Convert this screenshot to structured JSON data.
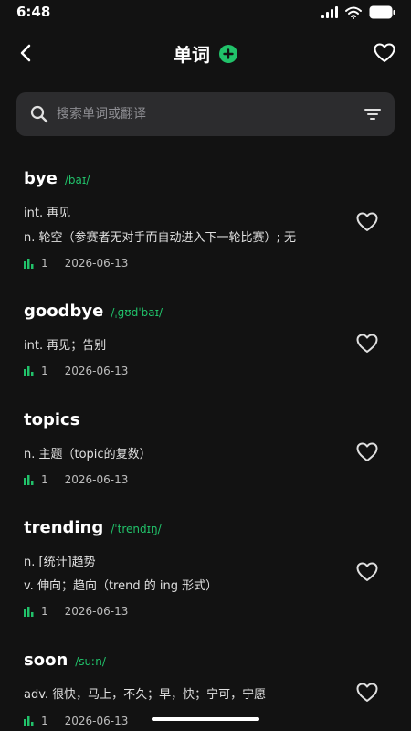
{
  "status_bar": {
    "time": "6:48"
  },
  "header": {
    "title": "单词"
  },
  "search": {
    "placeholder": "搜索单词或翻译"
  },
  "colors": {
    "accent": "#21c26a",
    "background": "#121212",
    "search_bg": "#2c2c2e"
  },
  "words": [
    {
      "word": "bye",
      "phonetic": "/baɪ/",
      "definitions": [
        "int. 再见",
        "n. 轮空（参赛者无对手而自动进入下一轮比赛）; 无"
      ],
      "count": "1",
      "date": "2026-06-13"
    },
    {
      "word": "goodbye",
      "phonetic": "/ˌɡʊdˈbaɪ/",
      "definitions": [
        "int. 再见；告别"
      ],
      "count": "1",
      "date": "2026-06-13"
    },
    {
      "word": "topics",
      "phonetic": "",
      "definitions": [
        "n. 主题（topic的复数）"
      ],
      "count": "1",
      "date": "2026-06-13"
    },
    {
      "word": "trending",
      "phonetic": "/ˈtrendɪŋ/",
      "definitions": [
        "n. [统计]趋势",
        "v. 伸向；趋向（trend 的 ing 形式）"
      ],
      "count": "1",
      "date": "2026-06-13"
    },
    {
      "word": "soon",
      "phonetic": "/suːn/",
      "definitions": [
        "adv. 很快，马上，不久；早，快；宁可，宁愿"
      ],
      "count": "1",
      "date": "2026-06-13"
    }
  ]
}
